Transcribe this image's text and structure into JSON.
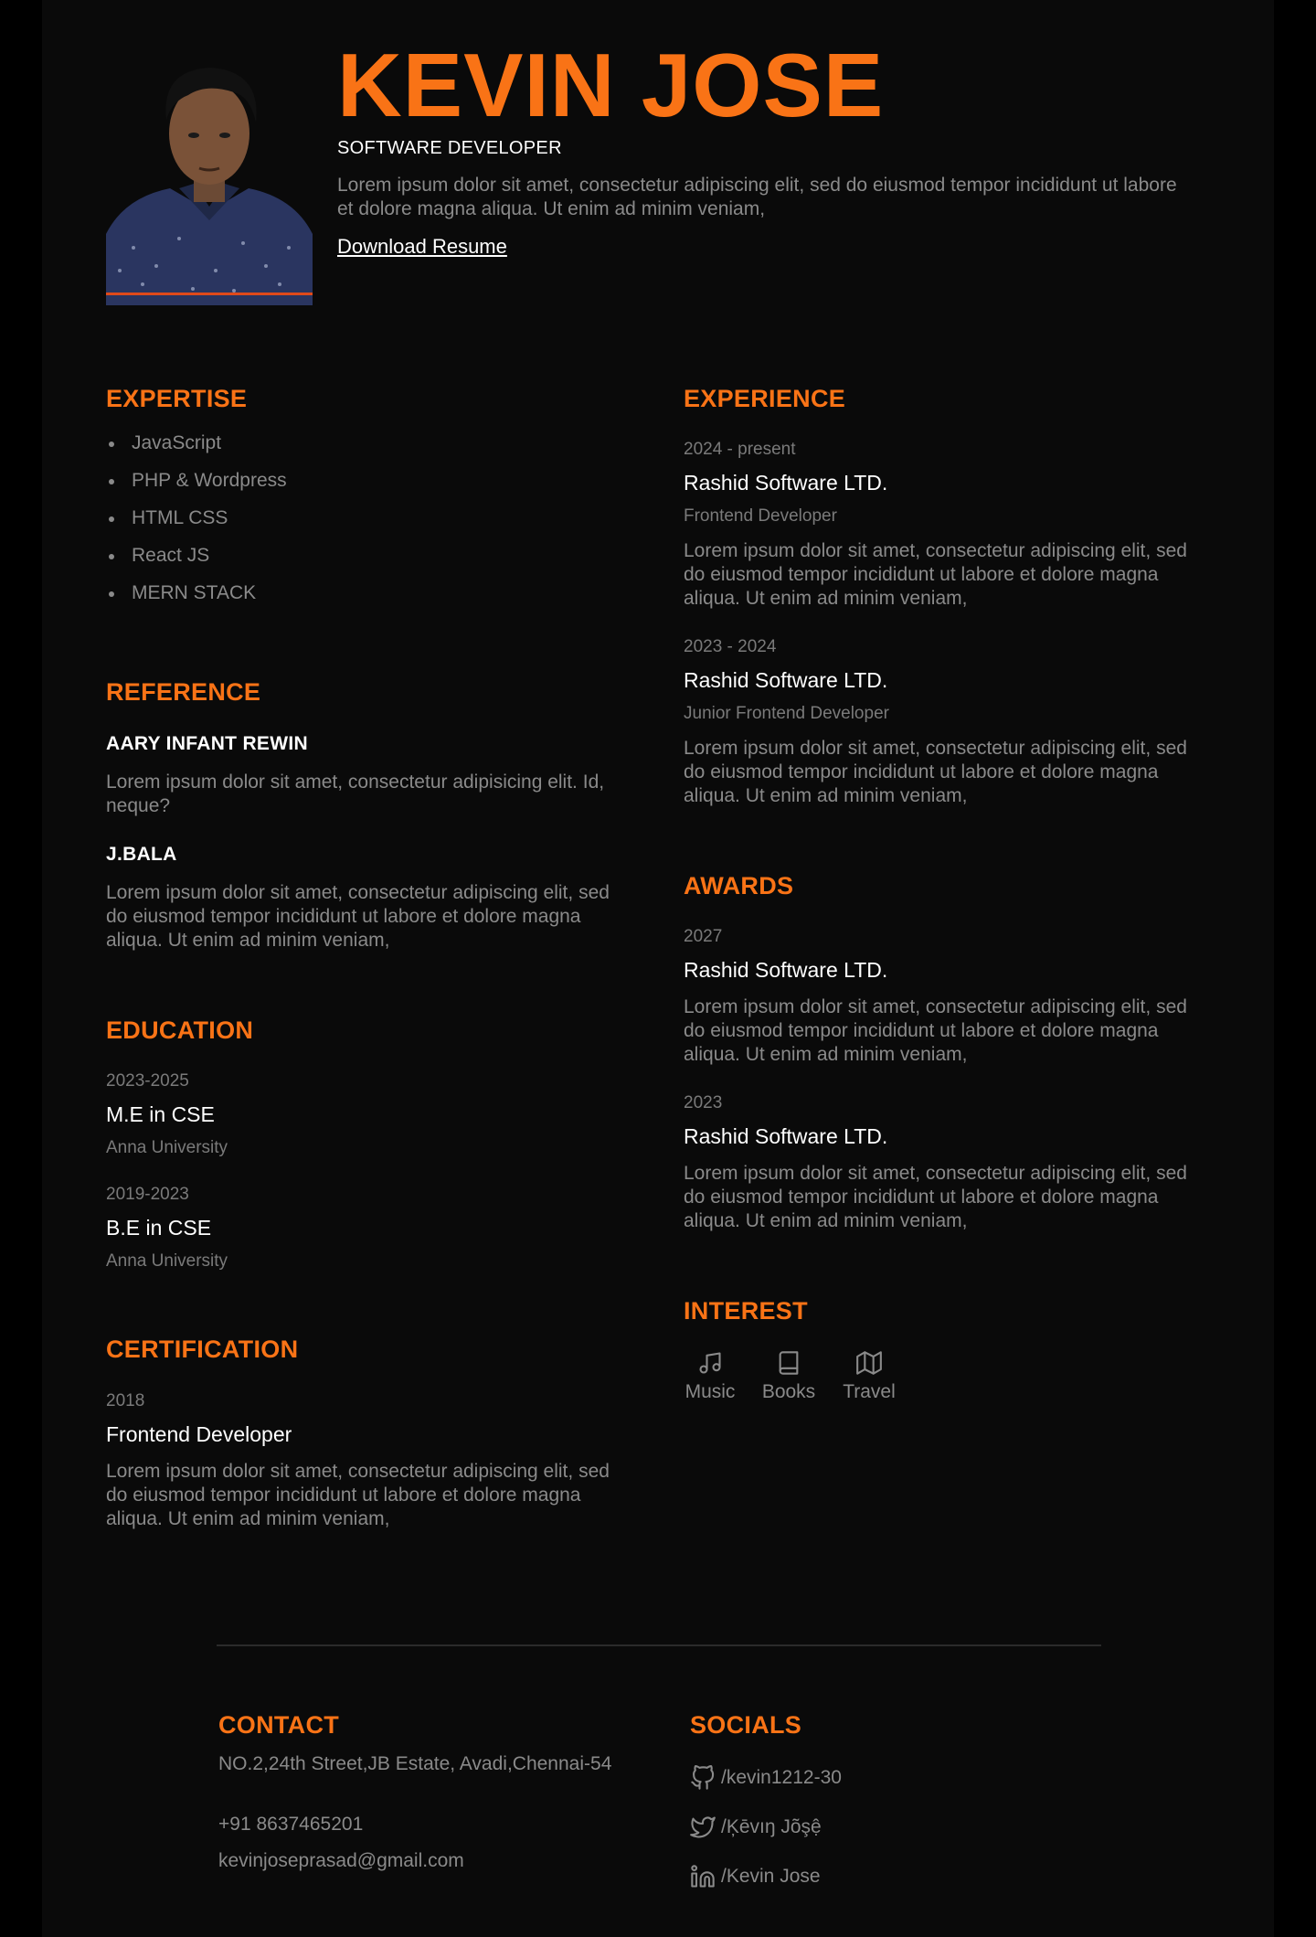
{
  "header": {
    "name": "KEVIN JOSE",
    "role": "SOFTWARE DEVELOPER",
    "intro": "Lorem ipsum dolor sit amet, consectetur adipiscing elit, sed do eiusmod tempor incididunt ut labore et dolore magna aliqua. Ut enim ad minim veniam,",
    "download_label": "Download Resume"
  },
  "expertise": {
    "title": "EXPERTISE",
    "items": [
      "JavaScript",
      "PHP & Wordpress",
      "HTML CSS",
      "React JS",
      "MERN STACK"
    ]
  },
  "reference": {
    "title": "REFERENCE",
    "items": [
      {
        "name": "AARY INFANT REWIN",
        "text": "Lorem ipsum dolor sit amet, consectetur adipisicing elit. Id, neque?"
      },
      {
        "name": "J.BALA",
        "text": "Lorem ipsum dolor sit amet, consectetur adipiscing elit, sed do eiusmod tempor incididunt ut labore et dolore magna aliqua. Ut enim ad minim veniam,"
      }
    ]
  },
  "education": {
    "title": "EDUCATION",
    "items": [
      {
        "years": "2023-2025",
        "degree": "M.E in CSE",
        "school": "Anna University"
      },
      {
        "years": "2019-2023",
        "degree": "B.E in CSE",
        "school": "Anna University"
      }
    ]
  },
  "certification": {
    "title": "CERTIFICATION",
    "items": [
      {
        "year": "2018",
        "name": "Frontend Developer",
        "text": "Lorem ipsum dolor sit amet, consectetur adipiscing elit, sed do eiusmod tempor incididunt ut labore et dolore magna aliqua. Ut enim ad minim veniam,"
      }
    ]
  },
  "experience": {
    "title": "EXPERIENCE",
    "items": [
      {
        "period": "2024 - present",
        "company": "Rashid Software LTD.",
        "position": "Frontend Developer",
        "text": "Lorem ipsum dolor sit amet, consectetur adipiscing elit, sed do eiusmod tempor incididunt ut labore et dolore magna aliqua. Ut enim ad minim veniam,"
      },
      {
        "period": "2023 - 2024",
        "company": "Rashid Software LTD.",
        "position": "Junior Frontend Developer",
        "text": "Lorem ipsum dolor sit amet, consectetur adipiscing elit, sed do eiusmod tempor incididunt ut labore et dolore magna aliqua. Ut enim ad minim veniam,"
      }
    ]
  },
  "awards": {
    "title": "AWARDS",
    "items": [
      {
        "year": "2027",
        "company": "Rashid Software LTD.",
        "text": "Lorem ipsum dolor sit amet, consectetur adipiscing elit, sed do eiusmod tempor incididunt ut labore et dolore magna aliqua. Ut enim ad minim veniam,"
      },
      {
        "year": "2023",
        "company": "Rashid Software LTD.",
        "text": "Lorem ipsum dolor sit amet, consectetur adipiscing elit, sed do eiusmod tempor incididunt ut labore et dolore magna aliqua. Ut enim ad minim veniam,"
      }
    ]
  },
  "interest": {
    "title": "INTEREST",
    "items": [
      {
        "label": "Music",
        "icon": "music-note-icon"
      },
      {
        "label": "Books",
        "icon": "book-icon"
      },
      {
        "label": "Travel",
        "icon": "map-icon"
      }
    ]
  },
  "contact": {
    "title": "CONTACT",
    "address": "NO.2,24th Street,JB Estate, Avadi,Chennai-54",
    "phone": "+91 8637465201",
    "email": "kevinjoseprasad@gmail.com"
  },
  "socials": {
    "title": "SOCIALS",
    "items": [
      {
        "label": "/kevin1212-30",
        "icon": "github-icon"
      },
      {
        "label": "/Ķēvıŋ Jõşệ",
        "icon": "twitter-icon"
      },
      {
        "label": "/Kevin Jose",
        "icon": "linkedin-icon"
      }
    ]
  },
  "colors": {
    "accent": "#f97316",
    "background": "#0a0a0a",
    "page_edge": "#000000",
    "muted_text": "#8a8a8a"
  }
}
